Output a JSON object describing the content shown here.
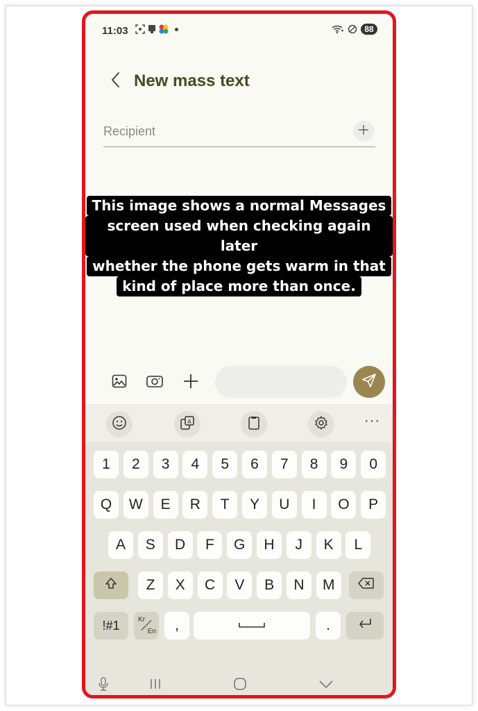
{
  "status_bar": {
    "time": "11:03",
    "battery": "88",
    "left_icons": [
      "screenshot-icon",
      "cast-icon",
      "photos-icon"
    ],
    "right_icons": [
      "wifi-icon",
      "do-not-disturb-icon"
    ]
  },
  "header": {
    "title": "New mass text"
  },
  "recipient": {
    "placeholder": "Recipient",
    "value": ""
  },
  "caption": {
    "lines": [
      "This image shows a normal Messages",
      "screen used when checking again later",
      "whether the phone gets warm in that",
      "kind of place more than once."
    ]
  },
  "compose": {
    "message_value": "",
    "icons": [
      "gallery-icon",
      "camera-icon",
      "add-icon",
      "send-icon"
    ]
  },
  "keyboard": {
    "toolbar_icons": [
      "emoji-icon",
      "translate-icon",
      "clipboard-icon",
      "settings-icon",
      "more-icon"
    ],
    "more_label": "···",
    "number_row": [
      "1",
      "2",
      "3",
      "4",
      "5",
      "6",
      "7",
      "8",
      "9",
      "0"
    ],
    "row1": [
      "Q",
      "W",
      "E",
      "R",
      "T",
      "Y",
      "U",
      "I",
      "O",
      "P"
    ],
    "row2": [
      "A",
      "S",
      "D",
      "F",
      "G",
      "H",
      "J",
      "K",
      "L"
    ],
    "row3": [
      "Z",
      "X",
      "C",
      "V",
      "B",
      "N",
      "M"
    ],
    "symbols_label": "!#1",
    "lang_top": "Kr",
    "lang_bottom": "En",
    "comma": ",",
    "period": "."
  },
  "colors": {
    "frame_border": "#e5141e",
    "title": "#4a4a22",
    "send_button": "#9c8650",
    "keyboard_bg": "#e7e6dc"
  }
}
